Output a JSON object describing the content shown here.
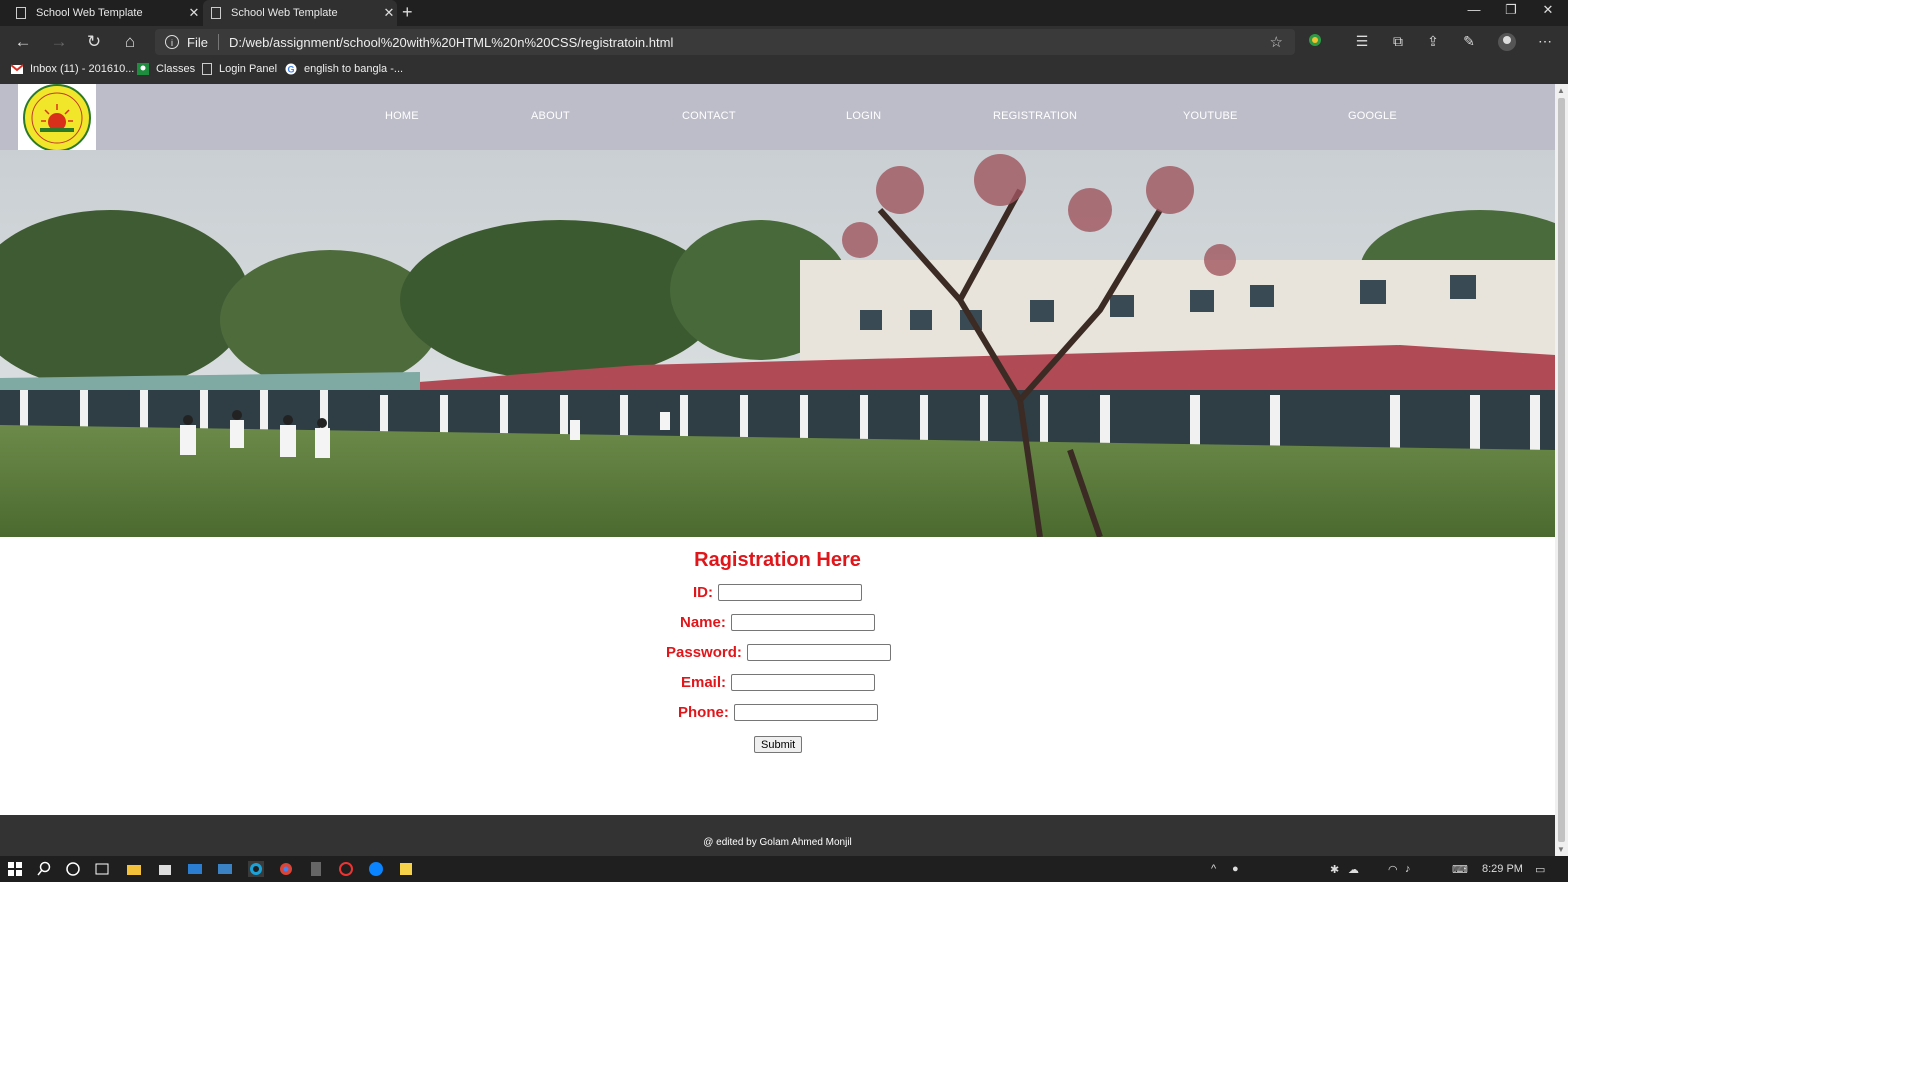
{
  "browser": {
    "tabs": [
      {
        "title": "School Web Template",
        "close": "✕"
      },
      {
        "title": "School Web Template",
        "close": "✕"
      }
    ],
    "new_tab": "+",
    "window_controls": {
      "minimize": "—",
      "restore": "❐",
      "close": "✕"
    },
    "nav": {
      "back": "←",
      "forward": "→",
      "reload": "↻",
      "home": "⌂"
    },
    "address": {
      "info": "i",
      "scheme": "File",
      "url": "D:/web/assignment/school%20with%20HTML%20n%20CSS/registratoin.html"
    },
    "bookmarks": [
      {
        "label": "Inbox (11) - 201610...",
        "icon": "gmail-icon"
      },
      {
        "label": "Classes",
        "icon": "classroom-icon"
      },
      {
        "label": "Login Panel",
        "icon": "page-icon"
      },
      {
        "label": "english to bangla -...",
        "icon": "google-icon"
      }
    ]
  },
  "site": {
    "menu": [
      "HOME",
      "ABOUT",
      "CONTACT",
      "LOGIN",
      "REGISTRATION",
      "YOUTUBE",
      "GOOGLE"
    ],
    "form": {
      "title": "Ragistration Here",
      "fields": [
        {
          "label": "ID:",
          "value": ""
        },
        {
          "label": "Name:",
          "value": ""
        },
        {
          "label": "Password:",
          "value": ""
        },
        {
          "label": "Email:",
          "value": ""
        },
        {
          "label": "Phone:",
          "value": ""
        }
      ],
      "submit": "Submit"
    },
    "footer": "@ edited by Golam Ahmed Monjil"
  },
  "taskbar": {
    "clock": "8:29 PM"
  },
  "colors": {
    "accent_red": "#e0161b",
    "header_bg": "#bdbdc9",
    "footer_bg": "#333333"
  }
}
